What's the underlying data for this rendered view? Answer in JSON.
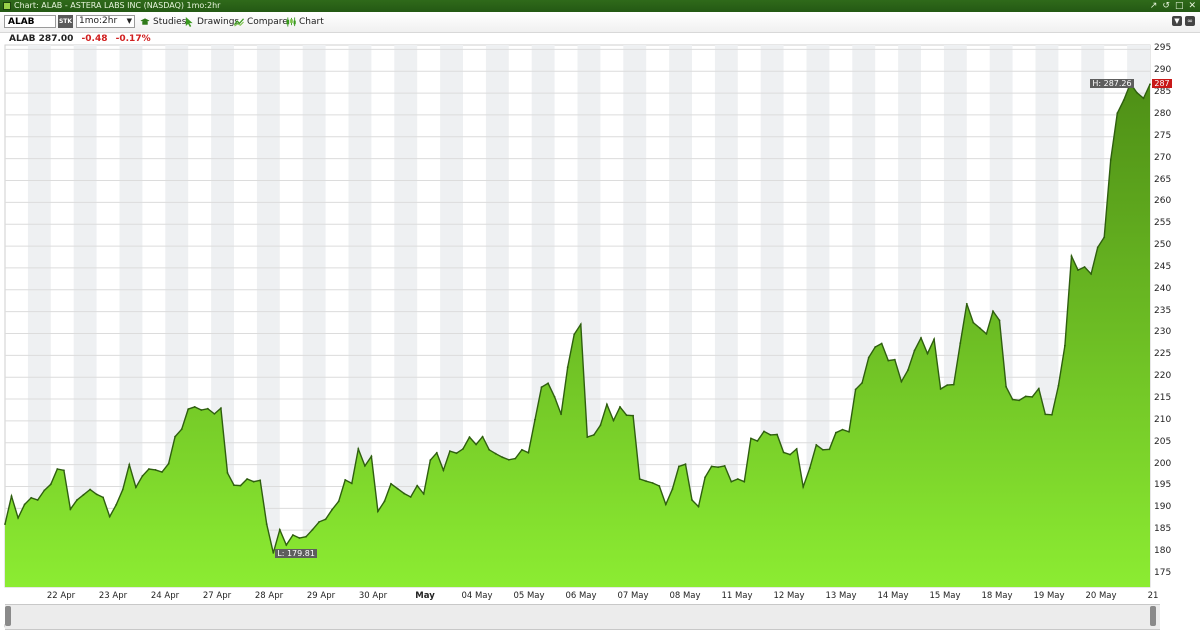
{
  "window": {
    "title": "Chart: ALAB - ASTERA LABS INC (NASDAQ) 1mo:2hr",
    "controls": [
      "↗",
      "↺",
      "□",
      "✕"
    ]
  },
  "toolbar": {
    "symbol": "ALAB",
    "security_type": "STK",
    "interval": "1mo:2hr",
    "studies_label": "Studies",
    "drawings_label": "Drawings",
    "compare_label": "Compare",
    "chart_label": "Chart",
    "menu_icon": "chevron-down-icon",
    "link_icon": "link-icon"
  },
  "quote": {
    "symbol": "ALAB",
    "last": "287.00",
    "change": "-0.48",
    "change_pct": "-0.17%"
  },
  "colors": {
    "area_top": "#4e8f16",
    "area_bottom": "#8cec32",
    "line": "#2f5f0f",
    "negative": "#d12020",
    "last_price_tag": "#c81818",
    "title_bar": "#2a6317"
  },
  "chart_data": {
    "type": "area",
    "title": "",
    "xlabel": "",
    "ylabel": "",
    "ylim": [
      172,
      296
    ],
    "y_ticks": [
      175,
      180,
      185,
      190,
      195,
      200,
      205,
      210,
      215,
      220,
      225,
      230,
      235,
      240,
      245,
      250,
      255,
      260,
      265,
      270,
      275,
      280,
      285,
      290,
      295
    ],
    "x_ticks": [
      "22 Apr",
      "23 Apr",
      "24 Apr",
      "27 Apr",
      "28 Apr",
      "29 Apr",
      "30 Apr",
      "May",
      "04 May",
      "05 May",
      "06 May",
      "07 May",
      "08 May",
      "11 May",
      "12 May",
      "13 May",
      "14 May",
      "15 May",
      "18 May",
      "19 May",
      "20 May",
      "21"
    ],
    "grid": true,
    "high_label": "H: 287.26",
    "low_label": "L: 179.81",
    "last_value_label": "287",
    "series": [
      {
        "values": [
          186.4,
          192.8,
          187.8,
          190.9,
          192.4,
          191.9,
          194.1,
          195.5,
          199.0,
          198.7,
          189.8,
          191.9,
          193.1,
          194.3,
          193.2,
          192.5,
          188.1,
          190.8,
          194.3,
          200.0,
          194.8,
          197.4,
          199.0,
          198.8,
          198.3,
          200.2,
          206.4,
          208.1,
          212.7,
          213.2,
          212.5,
          212.8,
          211.6,
          212.9,
          198.1,
          195.3,
          195.2,
          196.7,
          196.1,
          196.4,
          186.4,
          179.8,
          185.1,
          181.6,
          183.9,
          183.2,
          183.5,
          185.1,
          186.9,
          187.5,
          189.7,
          191.6,
          196.5,
          195.7,
          203.6,
          199.7,
          201.9,
          189.3,
          191.6,
          195.6,
          194.5,
          193.4,
          192.6,
          195.2,
          193.3,
          201.0,
          202.7,
          198.7,
          203.1,
          202.6,
          203.6,
          206.3,
          204.6,
          206.4,
          203.4,
          202.5,
          201.7,
          201.1,
          201.4,
          203.4,
          202.7,
          210.3,
          217.7,
          218.6,
          215.5,
          211.5,
          222.3,
          229.8,
          232.1,
          206.3,
          206.8,
          209.0,
          213.8,
          210.1,
          213.2,
          211.3,
          211.2,
          196.7,
          196.2,
          195.8,
          195.1,
          190.9,
          194.4,
          199.6,
          200.1,
          191.9,
          190.4,
          197.1,
          199.6,
          199.4,
          199.7,
          196.1,
          196.7,
          196.1,
          206.0,
          205.4,
          207.6,
          206.8,
          206.9,
          202.8,
          202.3,
          203.6,
          194.9,
          199.2,
          204.5,
          203.4,
          203.5,
          207.3,
          208.0,
          207.5,
          217.2,
          218.7,
          224.5,
          226.9,
          227.7,
          223.8,
          224.0,
          219.0,
          221.6,
          226.1,
          229.0,
          225.4,
          228.7,
          217.3,
          218.2,
          218.3,
          227.8,
          236.8,
          232.5,
          231.2,
          229.9,
          235.1,
          233.0,
          217.8,
          214.9,
          214.7,
          215.6,
          215.5,
          217.4,
          211.5,
          211.4,
          218.0,
          227.2,
          247.7,
          244.5,
          245.2,
          243.6,
          249.7,
          252.0,
          269.7,
          280.4,
          283.4,
          287.2,
          285.1,
          283.8,
          287.0
        ]
      }
    ]
  }
}
